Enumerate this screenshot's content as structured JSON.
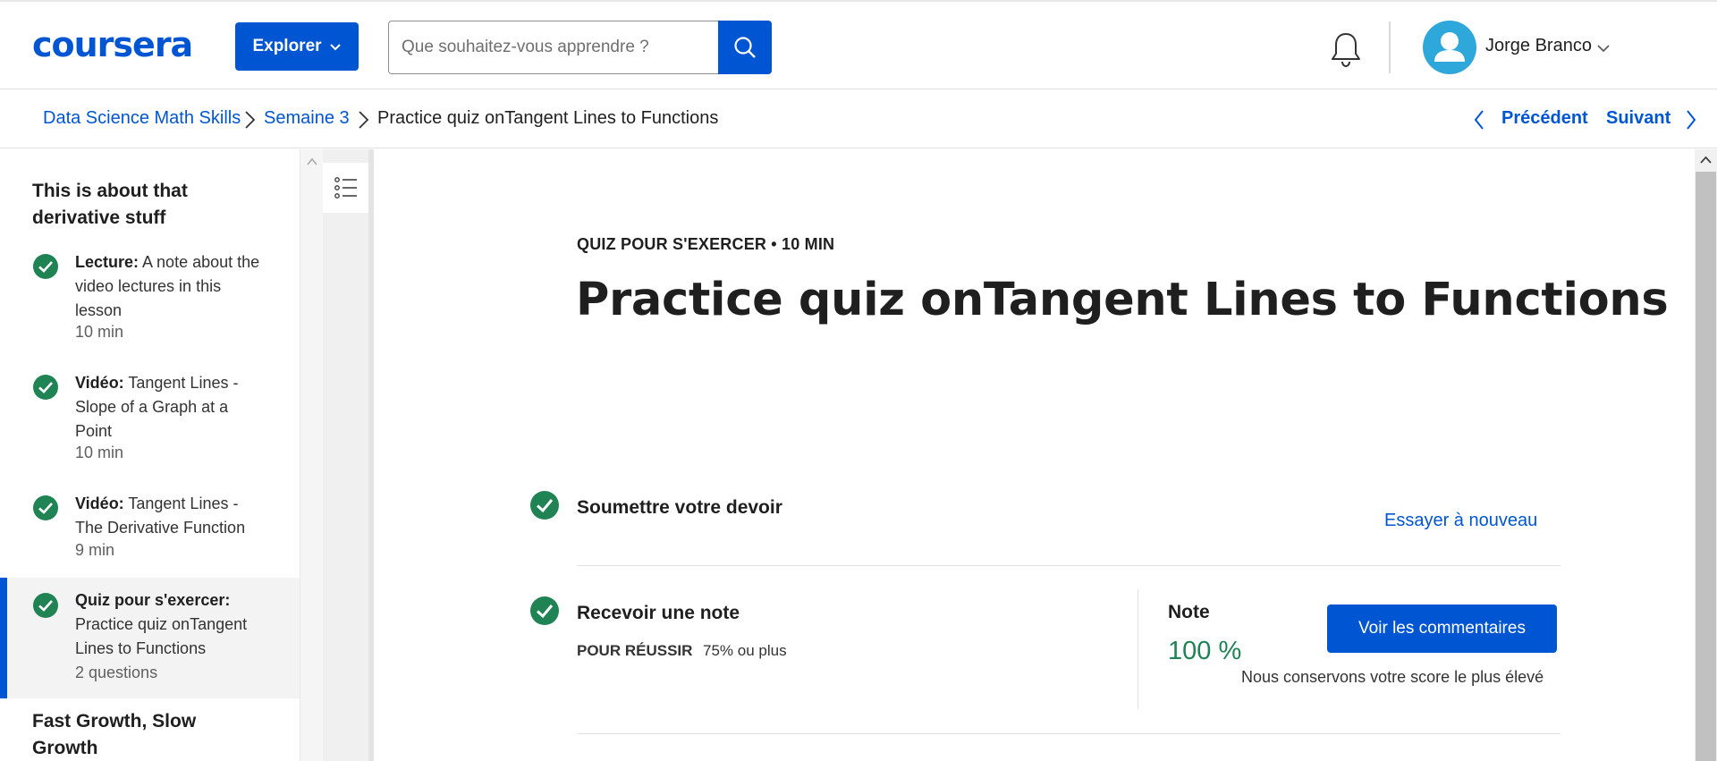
{
  "header": {
    "logo": "coursera",
    "explore_label": "Explorer",
    "search_placeholder": "Que souhaitez-vous apprendre ?",
    "user_name": "Jorge Branco"
  },
  "breadcrumb": {
    "items": [
      "Data Science Math Skills",
      "Semaine 3",
      "Practice quiz onTangent Lines to Functions"
    ],
    "prev_label": "Précédent",
    "next_label": "Suivant"
  },
  "sidebar": {
    "section_title": "This is about that derivative stuff",
    "items": [
      {
        "type": "Lecture:",
        "title": "A note about the video lectures in this lesson",
        "duration": "10 min",
        "completed": true,
        "active": false
      },
      {
        "type": "Vidéo:",
        "title": "Tangent Lines - Slope of a Graph at a Point",
        "duration": "10 min",
        "completed": true,
        "active": false
      },
      {
        "type": "Vidéo:",
        "title": "Tangent Lines - The Derivative Function",
        "duration": "9 min",
        "completed": true,
        "active": false
      },
      {
        "type": "Quiz pour s'exercer:",
        "title": "Practice quiz onTangent Lines to Functions",
        "duration": "2 questions",
        "completed": true,
        "active": true
      }
    ],
    "next_section_title": "Fast Growth, Slow Growth"
  },
  "main": {
    "kicker": "QUIZ POUR S'EXERCER • 10 MIN",
    "title": "Practice quiz onTangent Lines to Functions",
    "submit_step": {
      "title": "Soumettre votre devoir",
      "retry_label": "Essayer à nouveau"
    },
    "grade_step": {
      "title": "Recevoir une note",
      "pass_label": "POUR RÉUSSIR",
      "pass_value": "75% ou plus",
      "note_label": "Note",
      "note_value": "100 %",
      "feedback_label": "Voir les commentaires",
      "keep_note": "Nous conservons votre score le plus élevé"
    }
  },
  "colors": {
    "brand": "#0056d2",
    "success": "#1f8354",
    "check": "#1f8354",
    "avatar": "#2ea7da"
  },
  "icons": {
    "search": "search-icon",
    "bell": "bell-icon",
    "check": "check-circle-icon",
    "outline": "list-icon"
  }
}
